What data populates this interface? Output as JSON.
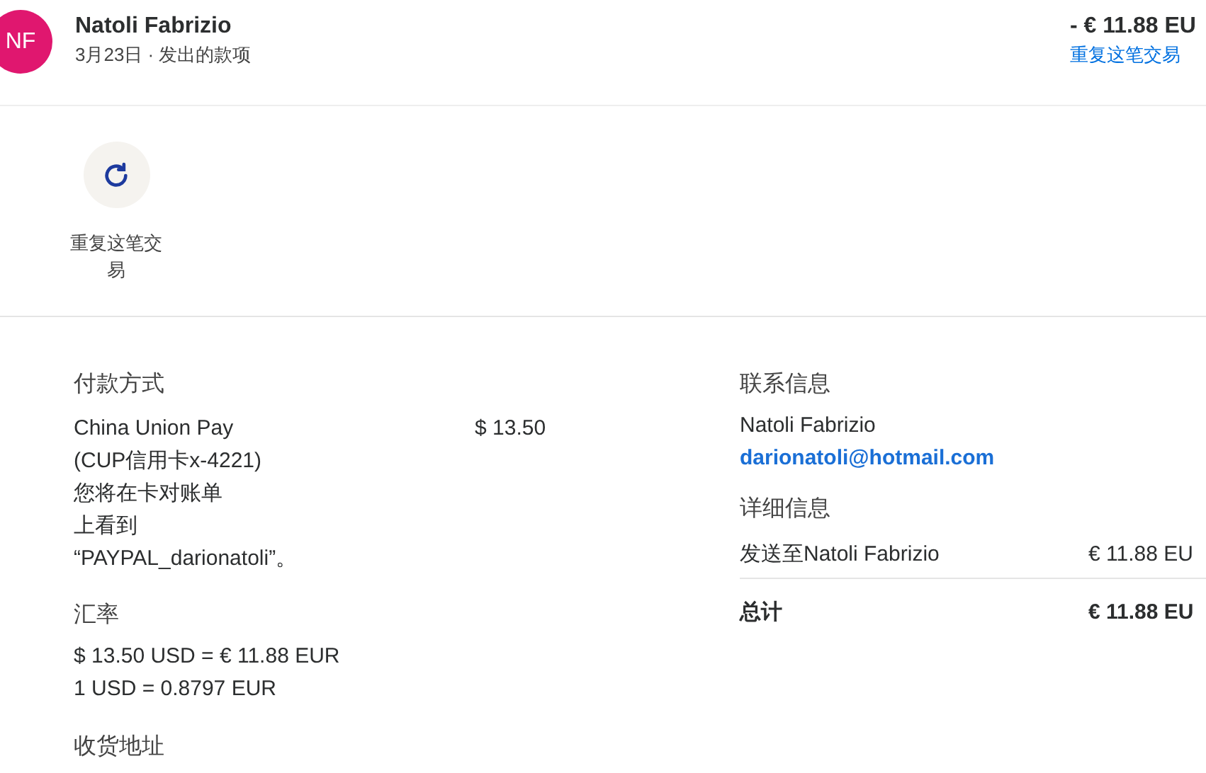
{
  "header": {
    "avatar_initials": "NF",
    "name": "Natoli Fabrizio",
    "subtitle": "3月23日 · 发出的款项",
    "amount": "- € 11.88 EU",
    "repeat_link": "重复这笔交易"
  },
  "actions": [
    {
      "label": "重复这笔交易"
    }
  ],
  "payment_method": {
    "title": "付款方式",
    "lines": [
      "China Union Pay",
      "(CUP信用卡x-4221)",
      "您将在卡对账单",
      "上看到",
      "“PAYPAL_darionatoli”。"
    ],
    "amount": "$ 13.50"
  },
  "exchange_rate": {
    "title": "汇率",
    "lines": [
      "$ 13.50 USD = € 11.88 EUR",
      "1 USD = 0.8797 EUR"
    ]
  },
  "shipping_address": {
    "title": "收货地址"
  },
  "contact": {
    "title": "联系信息",
    "name": "Natoli Fabrizio",
    "email": "darionatoli@hotmail.com"
  },
  "details": {
    "title": "详细信息",
    "rows": [
      {
        "kind": "item",
        "label": "发送至Natoli Fabrizio",
        "amount": "€ 11.88 EU"
      },
      {
        "kind": "total",
        "label": "总计",
        "amount": "€ 11.88 EU"
      }
    ]
  }
}
